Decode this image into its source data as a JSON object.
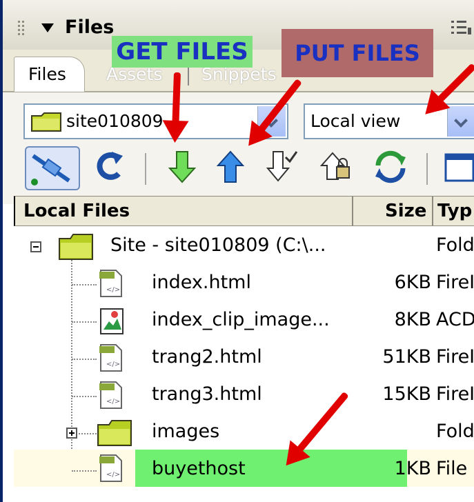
{
  "panel": {
    "title": "Files"
  },
  "tabs": [
    {
      "label": "Files",
      "active": true
    },
    {
      "label": "Assets",
      "active": false
    },
    {
      "label": "Snippets",
      "active": false
    }
  ],
  "site_select": {
    "value": "site010809"
  },
  "view_select": {
    "value": "Local view"
  },
  "toolbar": {
    "buttons": [
      "connect-icon",
      "refresh-icon",
      "get-files-icon",
      "put-files-icon",
      "check-out-icon",
      "check-in-icon",
      "synchronize-icon",
      "expand-icon"
    ]
  },
  "file_list": {
    "columns": {
      "name": "Local Files",
      "size": "Size",
      "type": "Typ"
    },
    "rows": [
      {
        "name": "Site - site010809 (C:\\...",
        "size": "",
        "type": "Fold",
        "icon": "folder-icon"
      },
      {
        "name": "index.html",
        "size": "6KB",
        "type": "FireI",
        "icon": "html-file-icon"
      },
      {
        "name": "index_clip_image...",
        "size": "8KB",
        "type": "ACD",
        "icon": "image-file-icon"
      },
      {
        "name": "trang2.html",
        "size": "51KB",
        "type": "FireI",
        "icon": "html-file-icon"
      },
      {
        "name": "trang3.html",
        "size": "15KB",
        "type": "FireI",
        "icon": "html-file-icon"
      },
      {
        "name": "images",
        "size": "",
        "type": "Fold",
        "icon": "folder-icon"
      },
      {
        "name": "buyethost",
        "size": "1KB",
        "type": "File",
        "icon": "file-icon"
      }
    ]
  },
  "callouts": {
    "get": "GET FILES",
    "put": "PUT FILES"
  },
  "colors": {
    "accent": "#0a246a",
    "highlight": "#70f070",
    "arrow": "#e00000",
    "put_bg": "#b06a6a"
  }
}
